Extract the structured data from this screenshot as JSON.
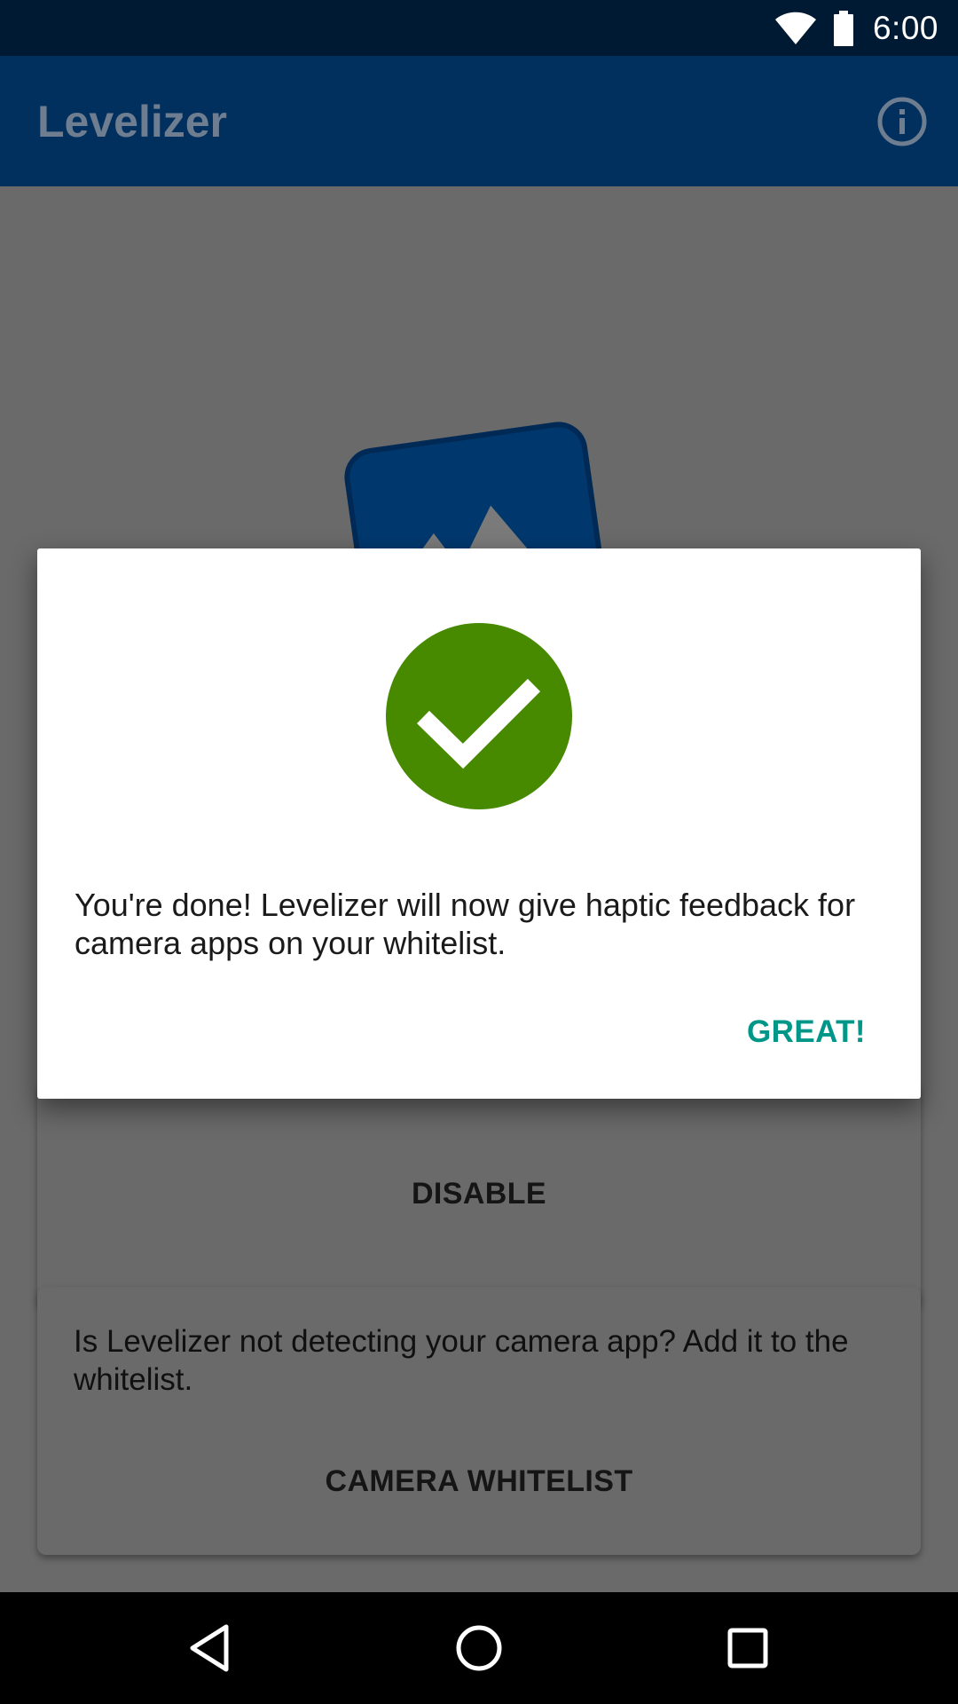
{
  "status_bar": {
    "time": "6:00",
    "wifi_icon": "wifi-icon",
    "battery_icon": "battery-icon"
  },
  "app_bar": {
    "title": "Levelizer",
    "info_icon": "info-icon"
  },
  "main": {
    "logo": "app-logo-icon",
    "disable_card": {
      "button_label": "DISABLE"
    },
    "whitelist_card": {
      "text": "Is Levelizer not detecting your camera app? Add it to the whitelist.",
      "button_label": "CAMERA WHITELIST"
    }
  },
  "dialog": {
    "icon": "check-circle-icon",
    "message": "You're done! Levelizer will now give haptic feedback for camera apps on your whitelist.",
    "button_label": "GREAT!"
  },
  "nav_bar": {
    "back_icon": "back-icon",
    "home_icon": "home-icon",
    "recents_icon": "recents-icon"
  },
  "colors": {
    "status_bar": "#011a33",
    "app_bar": "#02305e",
    "accent": "#009688",
    "success": "#478a00",
    "scrim_content": "#6a6a6a"
  }
}
